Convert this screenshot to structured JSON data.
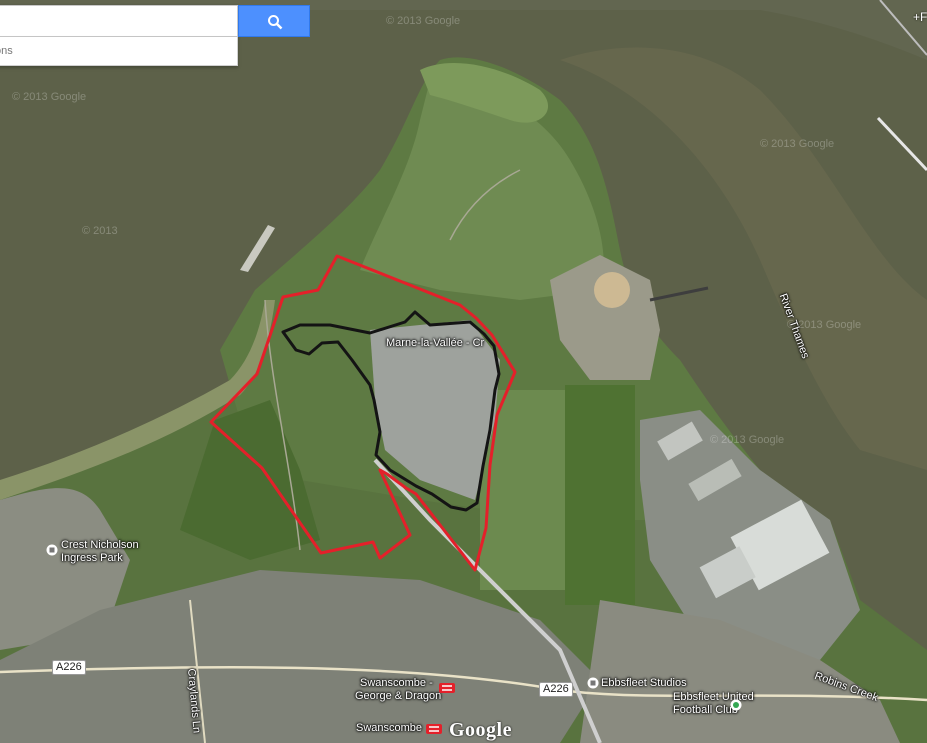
{
  "search": {
    "value": "",
    "suggest_text": "ons"
  },
  "colors": {
    "water": "#5b5f47",
    "water_light": "#6b6c52",
    "land": "#4f6b3a",
    "land_light": "#6f8a56",
    "urban": "#7b7f78",
    "boundary_red": "#e4202a",
    "boundary_black": "#141414",
    "accent_blue": "#4d90fe"
  },
  "labels": {
    "poi_marne": "Marne-la-Vallée - Cr",
    "river_thames": "River Thames",
    "crest_nicholson_1": "Crest Nicholson",
    "crest_nicholson_2": "Ingress Park",
    "ebbsfleet_studios": "Ebbsfleet Studios",
    "ebbsfleet_fc_1": "Ebbsfleet United",
    "ebbsfleet_fc_2": "Football Club",
    "robins_creek": "Robins Creek",
    "swanscombe_george_1": "Swanscombe -",
    "swanscombe_george_2": "George & Dragon",
    "swanscombe": "Swanscombe",
    "craylands_ln": "Craylands Ln",
    "road_a226_west": "A226",
    "road_a226_east": "A226",
    "google_logo": "Google",
    "corner_mark": "+F",
    "watermark_1": "© 2013 Google",
    "watermark_2": "© 2013 Google",
    "watermark_3": "© 2013 Google",
    "watermark_4": "© 2013 Google",
    "watermark_5": "© 2013",
    "watermark_6": "© 2013 Google"
  },
  "icons": {
    "search": "search-icon",
    "poi": "poi-marker-icon",
    "rail": "rail-station-icon",
    "stadium": "stadium-icon"
  }
}
